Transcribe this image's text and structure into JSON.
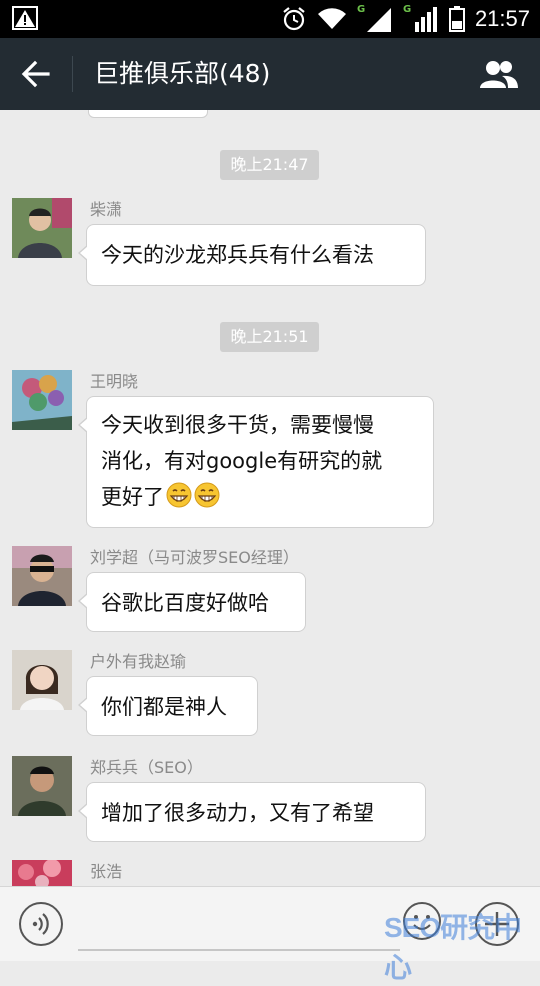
{
  "status_bar": {
    "time": "21:57",
    "sim1_label": "G",
    "sim2_label": "G",
    "icons": [
      "warning-icon",
      "alarm-icon",
      "wifi-icon",
      "signal-sim1-icon",
      "signal-sim2-icon",
      "battery-icon"
    ]
  },
  "header": {
    "title": "巨推俱乐部(48)",
    "background": "#232c33"
  },
  "timestamps": [
    "晚上21:47",
    "晚上21:51"
  ],
  "messages": [
    {
      "sender": "柴潇",
      "text": "今天的沙龙郑兵兵有什么看法"
    },
    {
      "sender": "王明晓",
      "lines": [
        "今天收到很多干货，需要慢慢",
        "消化，有对google有研究的就",
        "更好了"
      ],
      "emoji": "grin-emoji"
    },
    {
      "sender": "刘学超（马可波罗SEO经理）",
      "text": "谷歌比百度好做哈"
    },
    {
      "sender": "户外有我赵瑜",
      "text": "你们都是神人"
    },
    {
      "sender": "郑兵兵（SEO）",
      "text": "增加了很多动力，又有了希望"
    },
    {
      "sender": "张浩"
    }
  ],
  "input_bar": {
    "placeholder": "",
    "value": ""
  },
  "watermark": "SEO研究中心"
}
